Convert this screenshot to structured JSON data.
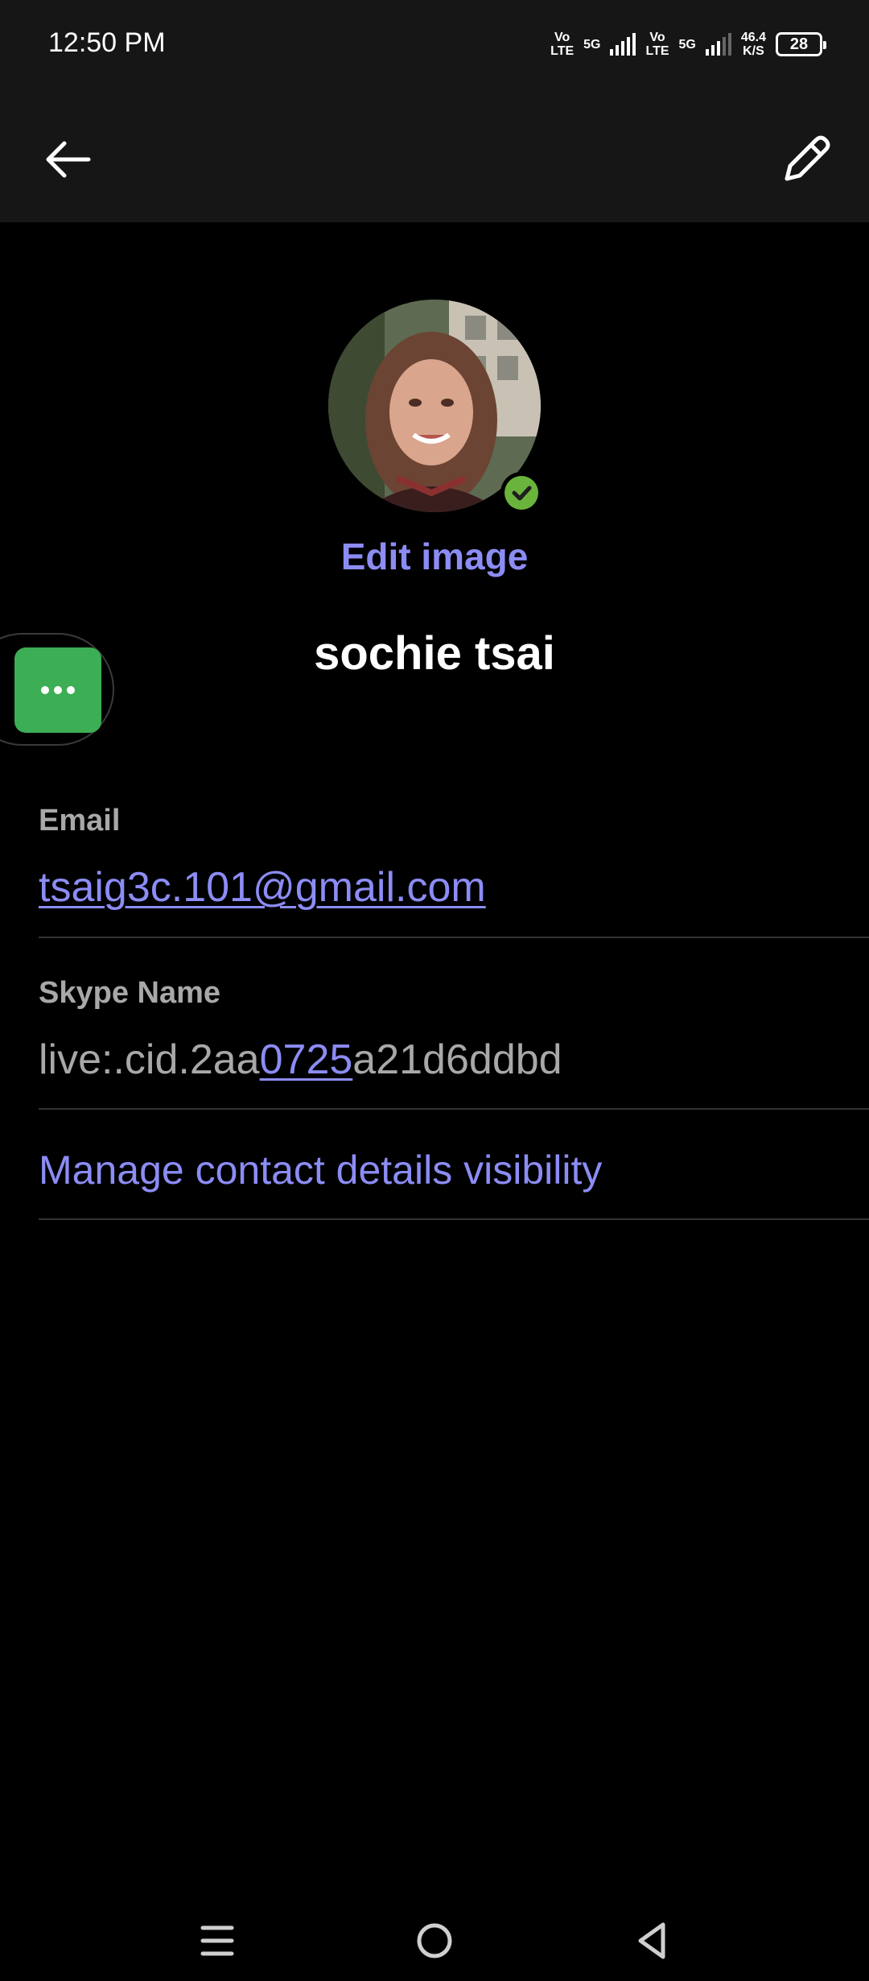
{
  "status_bar": {
    "time": "12:50 PM",
    "volte_1": [
      "Vo",
      "LTE"
    ],
    "net_1": "5G",
    "volte_2": [
      "Vo",
      "LTE"
    ],
    "net_2": "5G",
    "speed": [
      "46.4",
      "K/S"
    ],
    "battery": "28"
  },
  "top_bar": {
    "back_icon": "arrow-left-icon",
    "edit_icon": "pencil-icon"
  },
  "profile": {
    "avatar": "profile-photo",
    "presence_status": "online",
    "presence_color": "#6bb43b",
    "edit_image_label": "Edit image",
    "name": "sochie tsai"
  },
  "floating_button": {
    "icon": "more-dots-icon",
    "color": "#3cae55"
  },
  "details": {
    "email_label": "Email",
    "email_value": "tsaig3c.101@gmail.com",
    "skype_label": "Skype Name",
    "skype_prefix": "live:.cid.2aa",
    "skype_link": "0725",
    "skype_suffix": "a21d6ddbd",
    "manage_link": "Manage contact details visibility"
  },
  "colors": {
    "accent": "#8c8cf5",
    "background": "#000000",
    "bar": "#161616"
  },
  "nav_bar": {
    "menu_icon": "menu-icon",
    "home_icon": "home-circle-icon",
    "back_icon": "back-triangle-icon"
  }
}
